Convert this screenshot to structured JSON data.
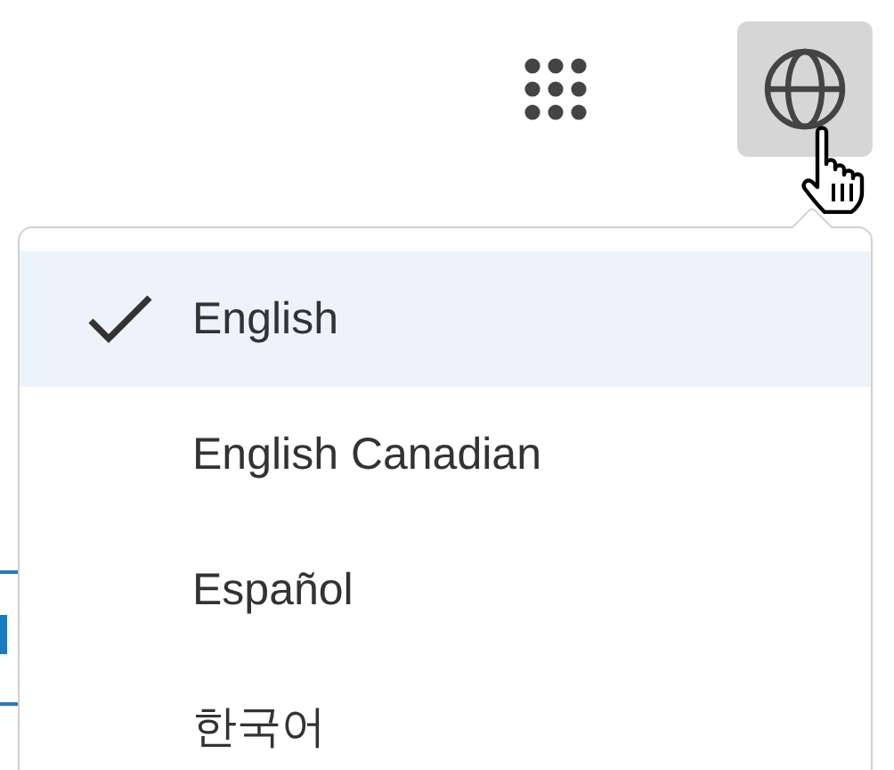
{
  "language_menu": {
    "expanded": true,
    "items": [
      {
        "label": "English",
        "selected": true
      },
      {
        "label": "English Canadian",
        "selected": false
      },
      {
        "label": "Español",
        "selected": false
      },
      {
        "label": "한국어",
        "selected": false
      }
    ]
  }
}
